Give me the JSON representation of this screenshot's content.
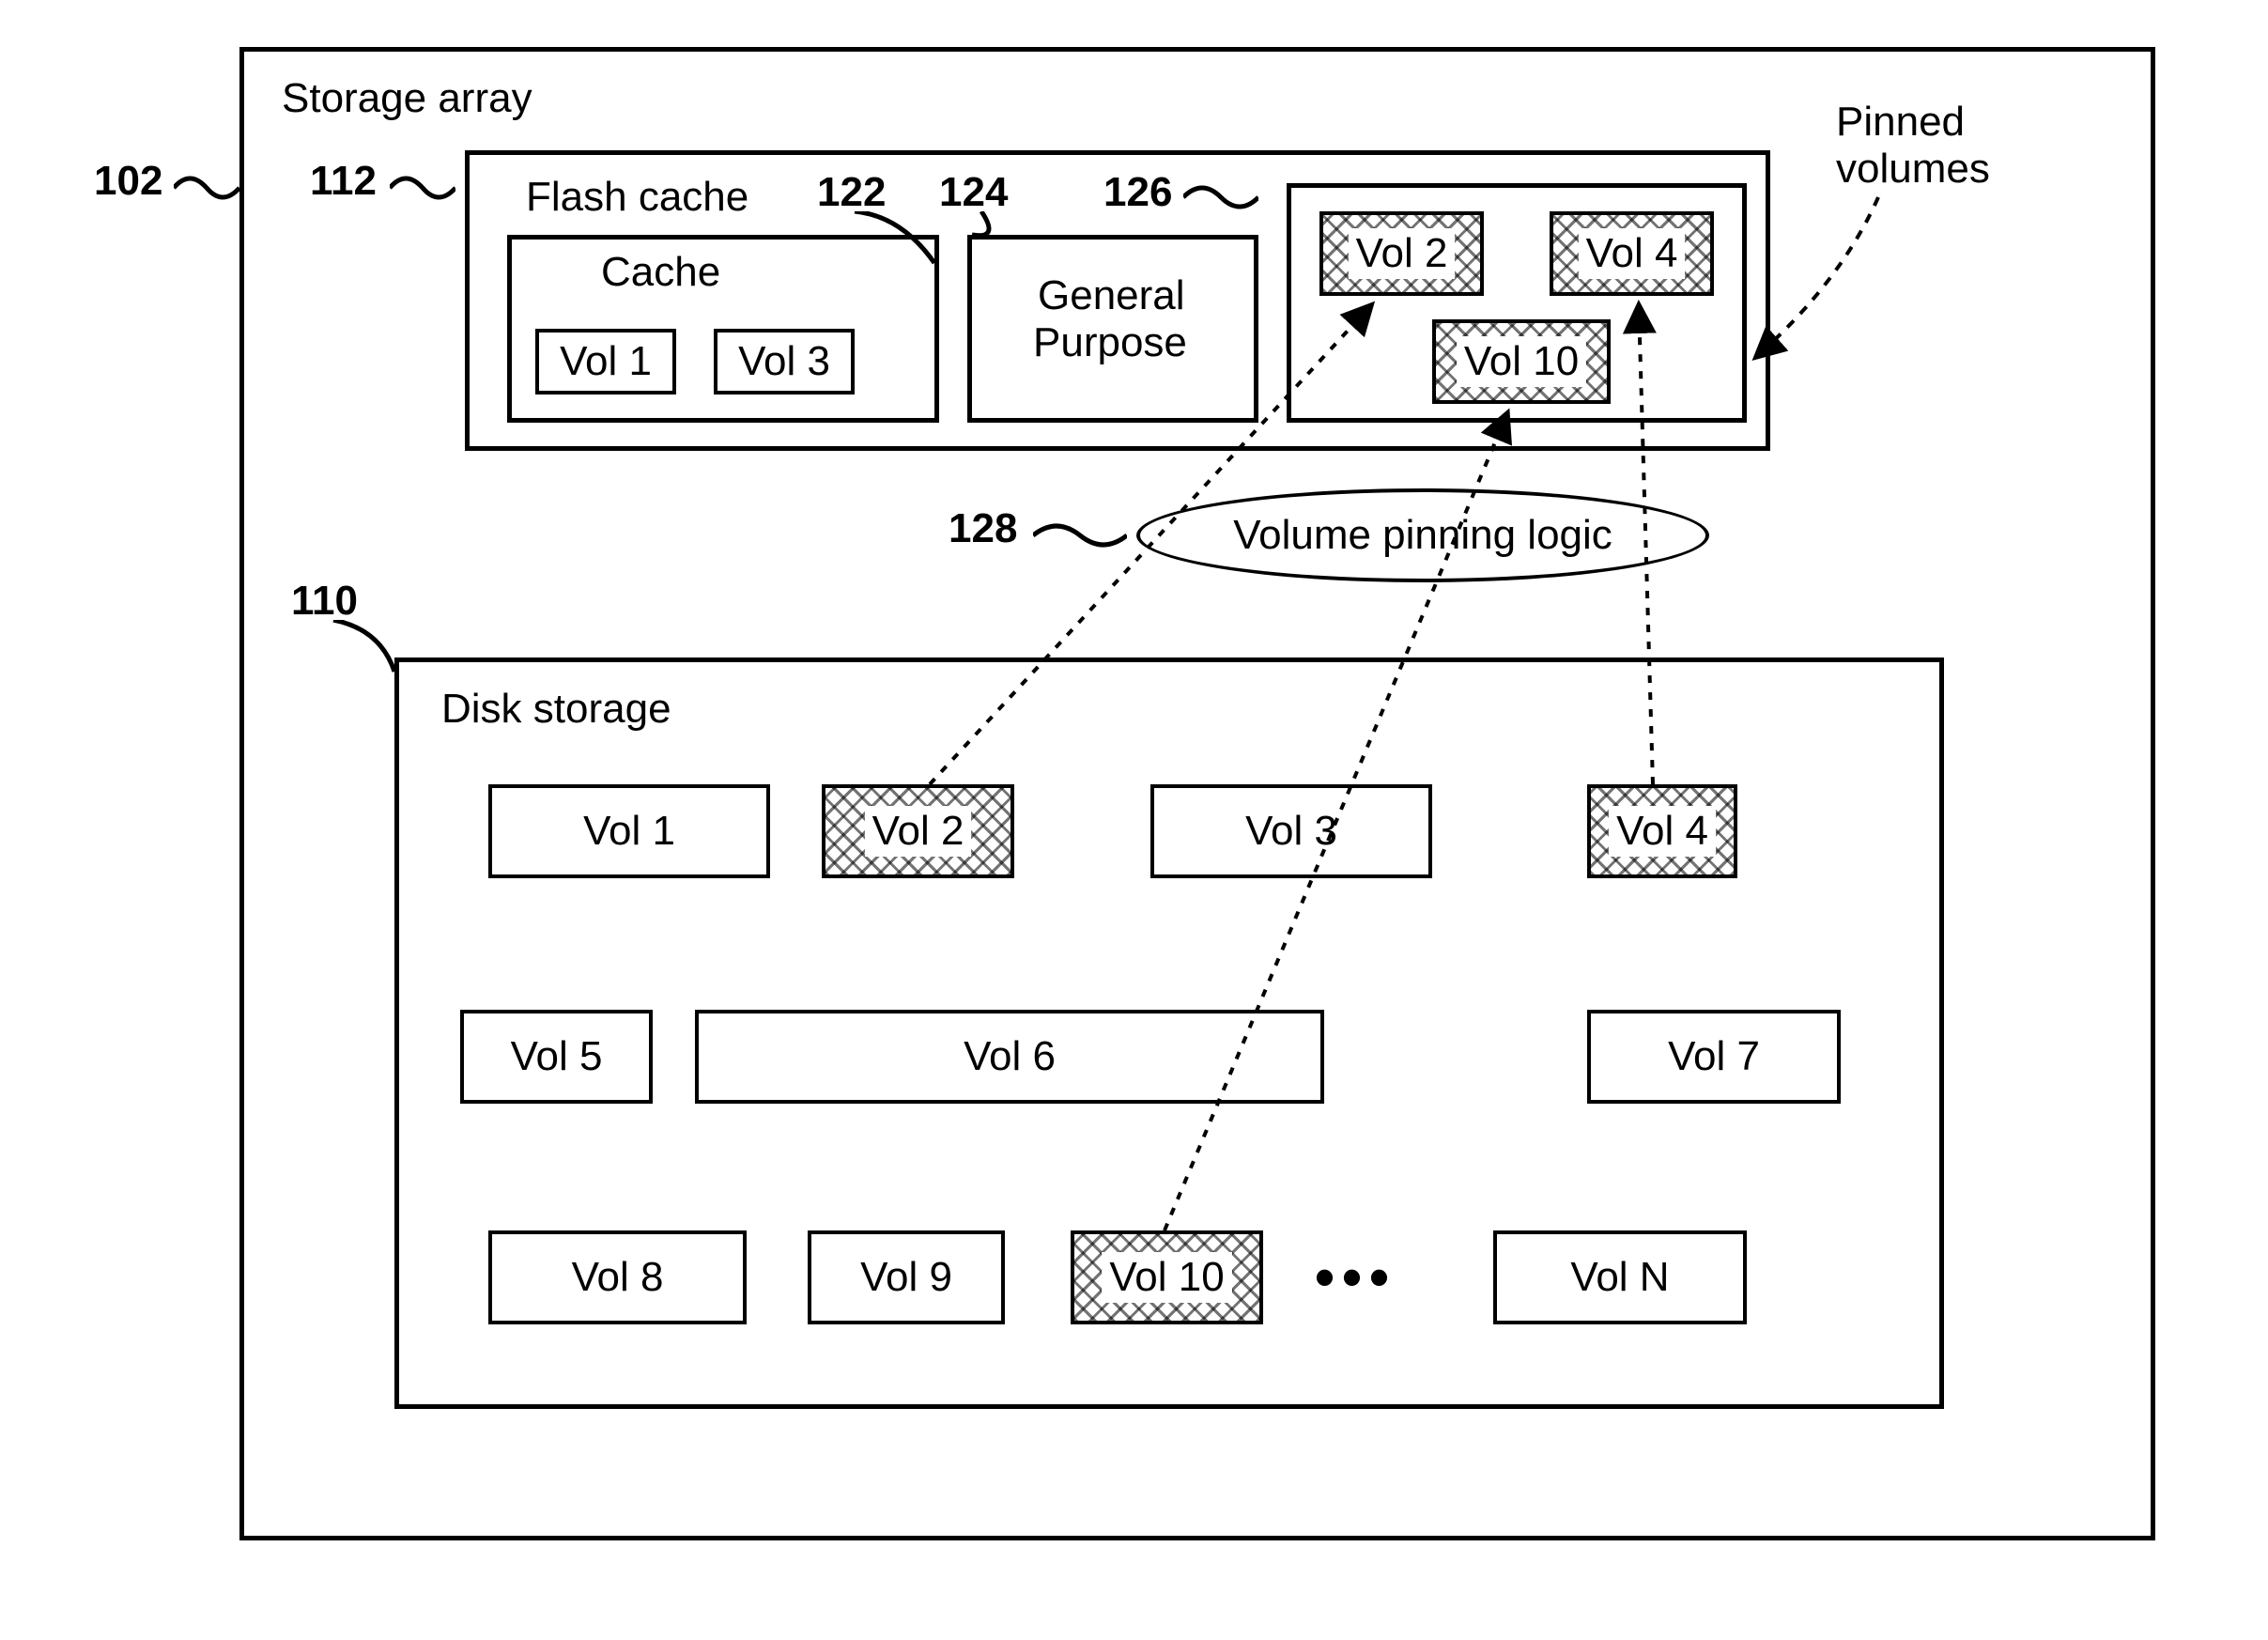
{
  "refs": {
    "r102": "102",
    "r112": "112",
    "r122": "122",
    "r124": "124",
    "r126": "126",
    "r128": "128",
    "r110": "110"
  },
  "titles": {
    "storage_array": "Storage array",
    "flash_cache": "Flash cache",
    "cache": "Cache",
    "general_purpose_l1": "General",
    "general_purpose_l2": "Purpose",
    "pinned_volumes_l1": "Pinned",
    "pinned_volumes_l2": "volumes",
    "vpl": "Volume pinning logic",
    "disk_storage": "Disk storage",
    "ellipsis": "•••"
  },
  "flash": {
    "cache_vols": {
      "v1": "Vol 1",
      "v3": "Vol 3"
    },
    "pinned": {
      "v2": "Vol 2",
      "v4": "Vol 4",
      "v10": "Vol 10"
    }
  },
  "disk": {
    "v1": "Vol 1",
    "v2": "Vol 2",
    "v3": "Vol 3",
    "v4": "Vol 4",
    "v5": "Vol 5",
    "v6": "Vol 6",
    "v7": "Vol 7",
    "v8": "Vol 8",
    "v9": "Vol 9",
    "v10": "Vol 10",
    "vn": "Vol N"
  }
}
